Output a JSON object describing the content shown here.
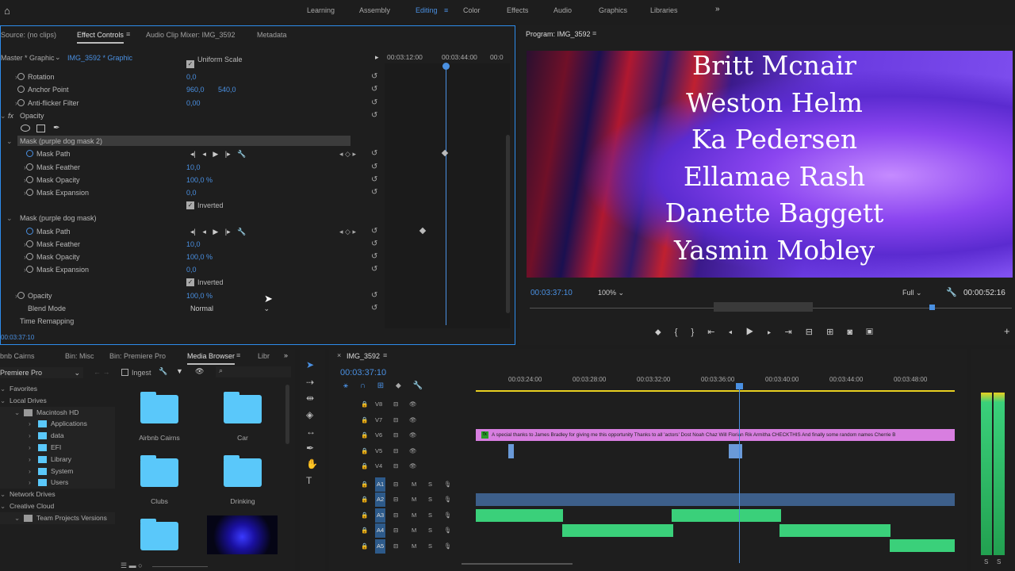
{
  "workspaces": [
    {
      "label": "Learning"
    },
    {
      "label": "Assembly"
    },
    {
      "label": "Editing",
      "active": true
    },
    {
      "label": "Color"
    },
    {
      "label": "Effects"
    },
    {
      "label": "Audio"
    },
    {
      "label": "Graphics"
    },
    {
      "label": "Libraries"
    }
  ],
  "effect_controls": {
    "tabs": [
      "Source: (no clips)",
      "Effect Controls",
      "Audio Clip Mixer: IMG_3592",
      "Metadata"
    ],
    "master": "Master * Graphic",
    "clip": "IMG_3592 * Graphic",
    "ruler": [
      "00:03:12:00",
      "00:03:44:00",
      "00:0"
    ],
    "rows": [
      {
        "label": "Uniform Scale",
        "type": "check",
        "indent": 235
      },
      {
        "label": "Rotation",
        "v1": "0,0",
        "chev": true,
        "indent": 35
      },
      {
        "label": "Anchor Point",
        "v1": "960,0",
        "v2": "540,0",
        "indent": 35
      },
      {
        "label": "Anti-flicker Filter",
        "v1": "0,00",
        "chev": true,
        "indent": 35
      },
      {
        "label": "Opacity",
        "type": "fx",
        "indent": 25
      },
      {
        "label": "",
        "type": "shapes"
      },
      {
        "label": "Mask (purple dog mask 2)",
        "type": "mask"
      },
      {
        "label": "Mask Path",
        "type": "path",
        "indent": 46
      },
      {
        "label": "Mask Feather",
        "v1": "10,0",
        "chev": true,
        "indent": 46
      },
      {
        "label": "Mask Opacity",
        "v1": "100,0 %",
        "chev": true,
        "indent": 46
      },
      {
        "label": "Mask Expansion",
        "v1": "0,0",
        "chev": true,
        "indent": 46
      },
      {
        "label": "Inverted",
        "type": "check",
        "indent": 235
      },
      {
        "label": "Mask (purple dog mask)",
        "type": "mask2"
      },
      {
        "label": "Mask Path",
        "type": "path",
        "indent": 46
      },
      {
        "label": "Mask Feather",
        "v1": "10,0",
        "chev": true,
        "indent": 46
      },
      {
        "label": "Mask Opacity",
        "v1": "100,0 %",
        "chev": true,
        "indent": 46
      },
      {
        "label": "Mask Expansion",
        "v1": "0,0",
        "chev": true,
        "indent": 46
      },
      {
        "label": "Inverted",
        "type": "check",
        "indent": 235
      },
      {
        "label": "Opacity",
        "v1": "100,0 %",
        "chev": true,
        "indent": 35
      },
      {
        "label": "Blend Mode",
        "type": "select",
        "value": "Normal",
        "indent": 35
      },
      {
        "label": "Time Remapping",
        "type": "plain",
        "indent": 25
      }
    ],
    "timecode": "00:03:37:10"
  },
  "program": {
    "title": "Program: IMG_3592",
    "names": [
      "Britt Mcnair",
      "Weston Helm",
      "Ka Pedersen",
      "Ellamae Rash",
      "Danette Baggett",
      "Yasmin Mobley"
    ],
    "timecode": "00:03:37:10",
    "zoom": "100%",
    "quality": "Full",
    "duration": "00:00:52:16"
  },
  "project": {
    "tabs": [
      "bnb Cairns",
      "Bin: Misc",
      "Bin: Premiere Pro",
      "Media Browser",
      "Libr"
    ],
    "location": "Premiere Pro",
    "ingest": "Ingest",
    "tree": [
      {
        "label": "Favorites",
        "lvl": 0
      },
      {
        "label": "Local Drives",
        "lvl": 0
      },
      {
        "label": "Macintosh HD",
        "lvl": 1
      },
      {
        "label": "Applications",
        "lvl": 2
      },
      {
        "label": "data",
        "lvl": 2
      },
      {
        "label": "EFI",
        "lvl": 2
      },
      {
        "label": "Library",
        "lvl": 2
      },
      {
        "label": "System",
        "lvl": 2
      },
      {
        "label": "Users",
        "lvl": 2
      },
      {
        "label": "Network Drives",
        "lvl": 0
      },
      {
        "label": "Creative Cloud",
        "lvl": 0
      },
      {
        "label": "Team Projects Versions",
        "lvl": 1
      }
    ],
    "folders": [
      "Airbnb Cairns",
      "Car",
      "Clubs",
      "Drinking",
      ""
    ]
  },
  "timeline": {
    "title": "IMG_3592",
    "timecode": "00:03:37:10",
    "ruler": [
      "00:03:24:00",
      "00:03:28:00",
      "00:03:32:00",
      "00:03:36:00",
      "00:03:40:00",
      "00:03:44:00",
      "00:03:48:00"
    ],
    "video_tracks": [
      "V8",
      "V7",
      "V6",
      "V5",
      "V4"
    ],
    "audio_tracks": [
      "A1",
      "A2",
      "A3",
      "A4",
      "A5"
    ],
    "mute": "M",
    "solo": "S",
    "clip_text": "A special thanks to James Bradley for giving me this opportunity  Thanks to all 'actors' Dost Noah Chaz Will Florian Rik Armitha  CHECKTHIS  And finally some random names Cherrie B",
    "clip_badge": "fx",
    "clip_color": "#d87ee0",
    "audio_color": "#3ad07a"
  },
  "meters": {
    "solo_labels": [
      "S",
      "S"
    ]
  }
}
